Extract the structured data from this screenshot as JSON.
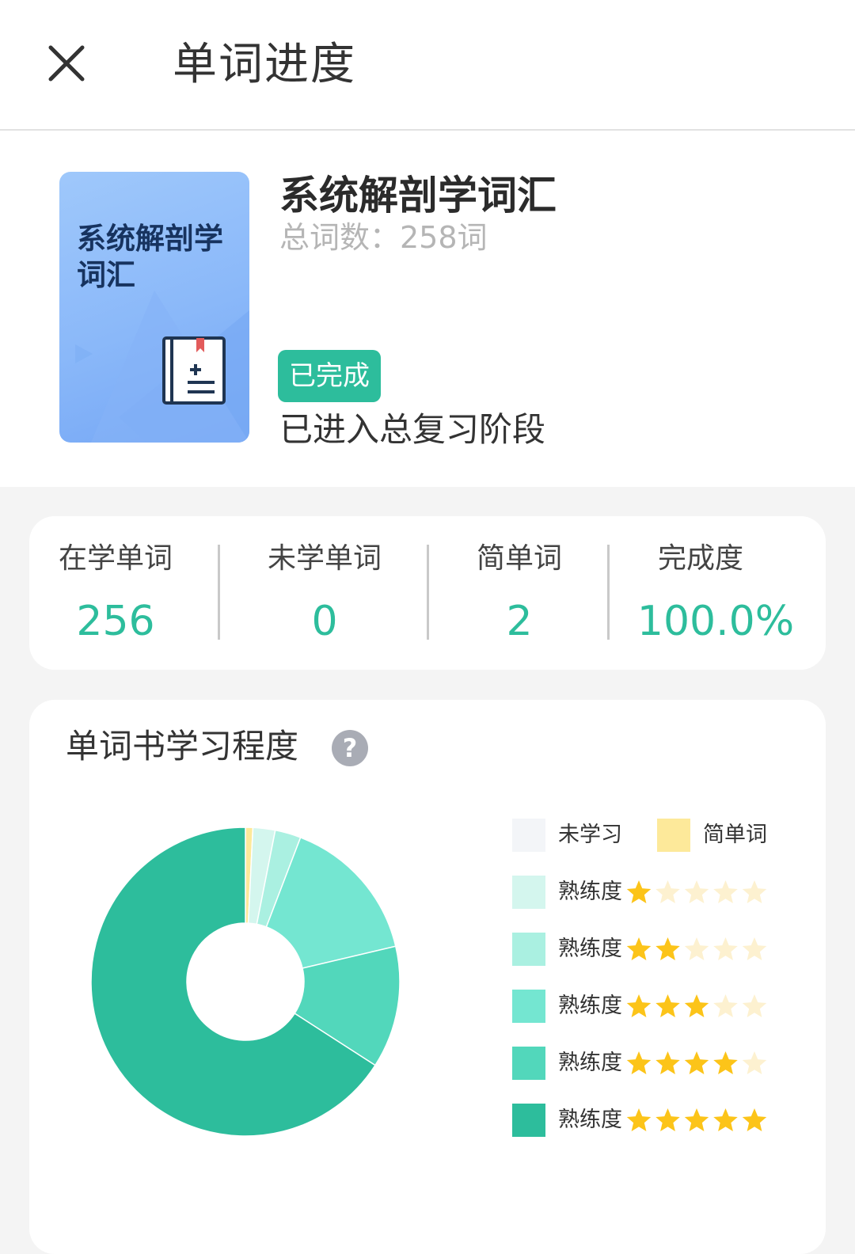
{
  "header": {
    "title": "单词进度",
    "close_icon": "close-icon"
  },
  "book": {
    "cover_title": "系统解剖学词汇",
    "title": "系统解剖学词汇",
    "word_count_label": "总词数：258词",
    "status_badge": "已完成",
    "stage": "已进入总复习阶段"
  },
  "stats": [
    {
      "label": "在学单词",
      "value": "256"
    },
    {
      "label": "未学单词",
      "value": "0"
    },
    {
      "label": "简单词",
      "value": "2"
    },
    {
      "label": "完成度",
      "value": "100.0%"
    }
  ],
  "chart_section": {
    "title": "单词书学习程度",
    "help_icon": "question-circle-icon"
  },
  "chart_data": {
    "type": "pie",
    "variant": "donut",
    "title": "单词书学习程度",
    "total": 258,
    "legend_position": "right",
    "series": [
      {
        "name": "未学习",
        "value": 0,
        "color": "#f3f5f8"
      },
      {
        "name": "简单词",
        "value": 2,
        "color": "#fde99a"
      },
      {
        "name": "熟练度",
        "stars": 1,
        "value": 6,
        "color": "#d4f6ee"
      },
      {
        "name": "熟练度",
        "stars": 2,
        "value": 7,
        "color": "#aaf0e1"
      },
      {
        "name": "熟练度",
        "stars": 3,
        "value": 40,
        "color": "#74e6d1"
      },
      {
        "name": "熟练度",
        "stars": 4,
        "value": 33,
        "color": "#52d7bb"
      },
      {
        "name": "熟练度",
        "stars": 5,
        "value": 170,
        "color": "#2dbd9c"
      }
    ]
  },
  "colors": {
    "accent": "#2dbd9c",
    "star_on": "#fcc419",
    "star_off": "#fdf1d0"
  }
}
